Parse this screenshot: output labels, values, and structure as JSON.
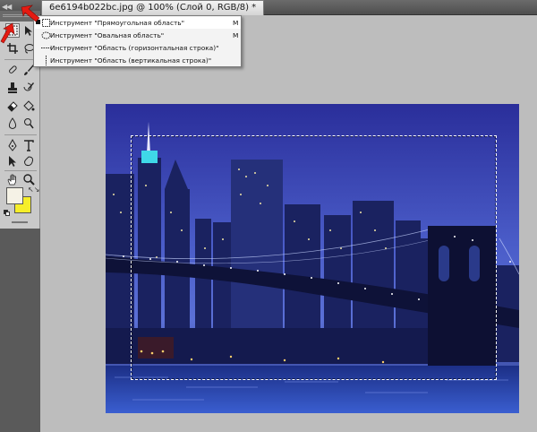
{
  "document_tab": {
    "title": "6e6194b022bc.jpg @ 100% (Слой 0, RGB/8) *"
  },
  "tab_scroll_icon": "double-chevron-left-icon",
  "tool_flyout": {
    "items": [
      {
        "label": "Инструмент \"Прямоугольная область\"",
        "shortcut": "M",
        "icon": "rect-marquee-icon",
        "selected": true
      },
      {
        "label": "Инструмент \"Овальная область\"",
        "shortcut": "M",
        "icon": "ellipse-marquee-icon",
        "selected": false
      },
      {
        "label": "Инструмент \"Область (горизонтальная строка)\"",
        "shortcut": "",
        "icon": "single-row-marquee-icon",
        "selected": false
      },
      {
        "label": "Инструмент \"Область (вертикальная строка)\"",
        "shortcut": "",
        "icon": "single-column-marquee-icon",
        "selected": false
      }
    ]
  },
  "colors": {
    "foreground": "#f5f2e6",
    "background": "#f6ee2a",
    "annotation_arrow": "#e51b12",
    "workspace": "#bdbdbd",
    "toolbox": "#c9c9c9"
  },
  "toolbox": {
    "tools": [
      "rect-marquee-icon",
      "move-icon",
      "crop-icon",
      "lasso-icon",
      "eyedropper-icon",
      "healing-brush-icon",
      "brush-icon",
      "clone-stamp-icon",
      "history-brush-icon",
      "eraser-icon",
      "paint-bucket-icon",
      "blur-icon",
      "dodge-icon",
      "pen-icon",
      "type-icon",
      "path-selection-icon",
      "custom-shape-icon",
      "hand-icon",
      "zoom-icon"
    ]
  },
  "canvas": {
    "image": "night-city-skyline-bridge",
    "selection": "rectangular-marquee"
  }
}
